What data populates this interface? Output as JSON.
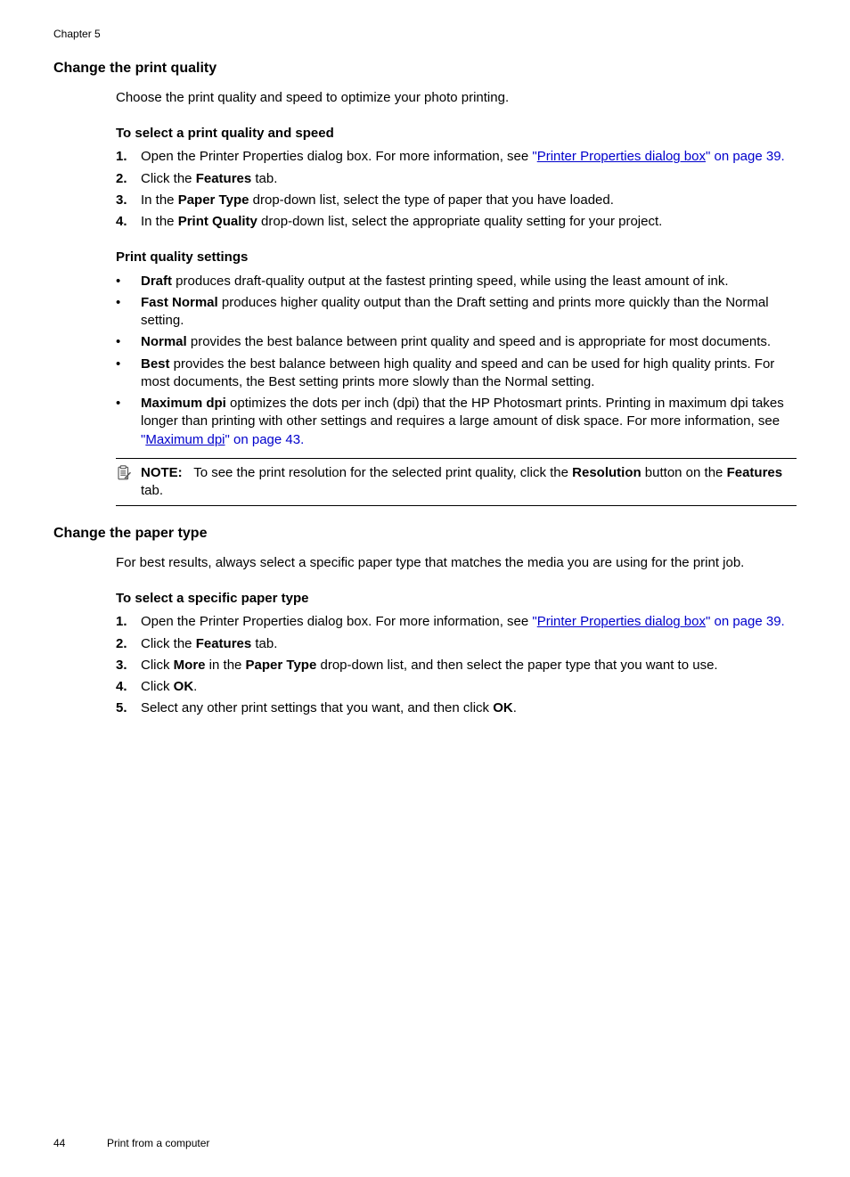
{
  "chapter_label": "Chapter 5",
  "section1": {
    "heading": "Change the print quality",
    "intro": "Choose the print quality and speed to optimize your photo printing.",
    "sub1_heading": "To select a print quality and speed",
    "step1_prefix": "Open the Printer Properties dialog box. For more information, see ",
    "step1_link_quote_open": "\"",
    "step1_link_text": "Printer Properties dialog box",
    "step1_link_quote_close": "\"",
    "step1_suffix": " on page 39.",
    "step2_a": "Click the ",
    "step2_b": "Features",
    "step2_c": " tab.",
    "step3_a": "In the ",
    "step3_b": "Paper Type",
    "step3_c": " drop-down list, select the type of paper that you have loaded.",
    "step4_a": "In the ",
    "step4_b": "Print Quality",
    "step4_c": " drop-down list, select the appropriate quality setting for your project.",
    "sub2_heading": "Print quality settings",
    "b1_a": "Draft",
    "b1_b": " produces draft-quality output at the fastest printing speed, while using the least amount of ink.",
    "b2_a": "Fast Normal",
    "b2_b": " produces higher quality output than the Draft setting and prints more quickly than the Normal setting.",
    "b3_a": "Normal",
    "b3_b": " provides the best balance between print quality and speed and is appropriate for most documents.",
    "b4_a": "Best",
    "b4_b": " provides the best balance between high quality and speed and can be used for high quality prints. For most documents, the Best setting prints more slowly than the Normal setting.",
    "b5_a": "Maximum dpi",
    "b5_b": " optimizes the dots per inch (dpi) that the HP Photosmart prints. Printing in maximum dpi takes longer than printing with other settings and requires a large amount of disk space. For more information, see ",
    "b5_link_quote_open": "\"",
    "b5_link_text": "Maximum dpi",
    "b5_link_quote_close": "\"",
    "b5_suffix": " on page 43.",
    "note_label": "NOTE:",
    "note_a": "To see the print resolution for the selected print quality, click the ",
    "note_b": "Resolution",
    "note_c": " button on the ",
    "note_d": "Features",
    "note_e": " tab."
  },
  "section2": {
    "heading": "Change the paper type",
    "intro": "For best results, always select a specific paper type that matches the media you are using for the print job.",
    "sub1_heading": "To select a specific paper type",
    "step1_prefix": "Open the Printer Properties dialog box. For more information, see ",
    "step1_link_quote_open": "\"",
    "step1_link_text": "Printer Properties dialog box",
    "step1_link_quote_close": "\"",
    "step1_suffix": " on page 39.",
    "step2_a": "Click the ",
    "step2_b": "Features",
    "step2_c": " tab.",
    "step3_a": "Click ",
    "step3_b": "More",
    "step3_c": " in the ",
    "step3_d": "Paper Type",
    "step3_e": " drop-down list, and then select the paper type that you want to use.",
    "step4_a": "Click ",
    "step4_b": "OK",
    "step4_c": ".",
    "step5_a": "Select any other print settings that you want, and then click ",
    "step5_b": "OK",
    "step5_c": "."
  },
  "footer": {
    "page": "44",
    "title": "Print from a computer"
  },
  "markers": {
    "n1": "1.",
    "n2": "2.",
    "n3": "3.",
    "n4": "4.",
    "n5": "5.",
    "bullet": "•"
  }
}
